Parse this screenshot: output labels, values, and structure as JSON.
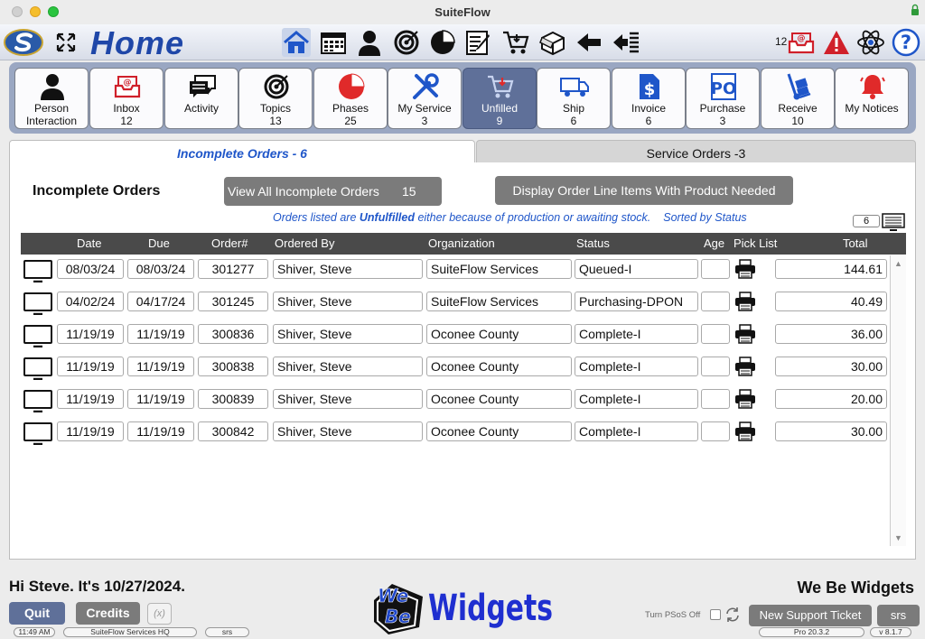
{
  "window": {
    "title": "SuiteFlow"
  },
  "header": {
    "title": "Home",
    "inbox_count": "12"
  },
  "toolbar_icons": [
    "home-icon",
    "calendar-icon",
    "person-icon",
    "target-icon",
    "pie-chart-icon",
    "edit-list-icon",
    "cart-icon",
    "box-icon",
    "back-arrow-icon",
    "back-list-icon",
    "inbox-icon",
    "alert-icon",
    "atom-icon",
    "help-icon"
  ],
  "modules": [
    {
      "label": "Person",
      "count": "Interaction"
    },
    {
      "label": "Inbox",
      "count": "12"
    },
    {
      "label": "Activity",
      "count": ""
    },
    {
      "label": "Topics",
      "count": "13"
    },
    {
      "label": "Phases",
      "count": "25"
    },
    {
      "label": "My Service",
      "count": "3"
    },
    {
      "label": "Unfilled",
      "count": "9"
    },
    {
      "label": "Ship",
      "count": "6"
    },
    {
      "label": "Invoice",
      "count": "6"
    },
    {
      "label": "Purchase",
      "count": "3"
    },
    {
      "label": "Receive",
      "count": "10"
    },
    {
      "label": "My Notices",
      "count": ""
    }
  ],
  "tabs": {
    "incomplete": "Incomplete Orders - 6",
    "service": "Service Orders -3"
  },
  "section": {
    "title": "Incomplete Orders",
    "view_all_label": "View All Incomplete Orders",
    "view_all_count": "15",
    "display_label": "Display Order Line Items With Product Needed",
    "note_pre": "Orders listed are ",
    "note_bold": "Unfulfilled",
    "note_post": " either because of production or awaiting stock.",
    "note_sorted": "Sorted by Status",
    "page_count": "6"
  },
  "table": {
    "headers": {
      "date": "Date",
      "due": "Due",
      "order": "Order#",
      "by": "Ordered By",
      "org": "Organization",
      "status": "Status",
      "age": "Age",
      "pick": "Pick List",
      "total": "Total"
    },
    "rows": [
      {
        "date": "08/03/24",
        "due": "08/03/24",
        "order": "301277",
        "by": "Shiver, Steve",
        "org": "SuiteFlow Services",
        "status": "Queued-I",
        "age": "",
        "total": "144.61"
      },
      {
        "date": "04/02/24",
        "due": "04/17/24",
        "order": "301245",
        "by": "Shiver, Steve",
        "org": "SuiteFlow Services",
        "status": "Purchasing-DPON",
        "age": "",
        "total": "40.49"
      },
      {
        "date": "11/19/19",
        "due": "11/19/19",
        "order": "300836",
        "by": "Shiver, Steve",
        "org": "Oconee County",
        "status": "Complete-I",
        "age": "",
        "total": "36.00"
      },
      {
        "date": "11/19/19",
        "due": "11/19/19",
        "order": "300838",
        "by": "Shiver, Steve",
        "org": "Oconee County",
        "status": "Complete-I",
        "age": "",
        "total": "30.00"
      },
      {
        "date": "11/19/19",
        "due": "11/19/19",
        "order": "300839",
        "by": "Shiver, Steve",
        "org": "Oconee County",
        "status": "Complete-I",
        "age": "",
        "total": "20.00"
      },
      {
        "date": "11/19/19",
        "due": "11/19/19",
        "order": "300842",
        "by": "Shiver, Steve",
        "org": "Oconee County",
        "status": "Complete-I",
        "age": "",
        "total": "30.00"
      }
    ]
  },
  "footer": {
    "greeting": "Hi Steve. It's 10/27/2024.",
    "company": "We Be Widgets",
    "quit": "Quit",
    "credits": "Credits",
    "fx": "(x)",
    "time": "11:49 AM",
    "location": "SuiteFlow Services HQ",
    "user": "srs",
    "psos": "Turn PSoS Off",
    "support": "New Support Ticket",
    "srs_btn": "srs",
    "version": "Pro 20.3.2",
    "build": "v 8.1.7",
    "logo_we": "We",
    "logo_be": "Be",
    "logo_widgets": "Widgets"
  },
  "colors": {
    "brand_blue": "#1f47a8",
    "accent_blue": "#1f56c9",
    "active_module": "#5f7099",
    "button_gray": "#7b7b7b"
  }
}
